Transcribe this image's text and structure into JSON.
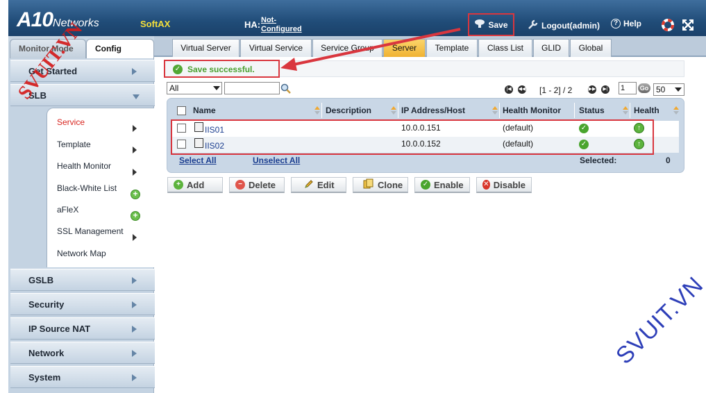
{
  "header": {
    "logo_main": "A10",
    "logo_sub": "Networks",
    "product": "SoftAX",
    "ha_label": "HA:",
    "ha_status": "Not-Configured",
    "save_label": "Save",
    "logout_label": "Logout(admin)",
    "help_label": "Help"
  },
  "mode_tabs": {
    "monitor": "Monitor Mode",
    "config": "Config Mode"
  },
  "sidebar": {
    "items": [
      {
        "label": "Get Started"
      },
      {
        "label": "SLB"
      },
      {
        "label": "GSLB"
      },
      {
        "label": "Security"
      },
      {
        "label": "IP Source NAT"
      },
      {
        "label": "Network"
      },
      {
        "label": "System"
      }
    ],
    "submenu": [
      {
        "label": "Service"
      },
      {
        "label": "Template"
      },
      {
        "label": "Health Monitor"
      },
      {
        "label": "Black-White List"
      },
      {
        "label": "aFleX"
      },
      {
        "label": "SSL Management"
      },
      {
        "label": "Network Map"
      }
    ]
  },
  "tabs": [
    {
      "label": "Virtual Server"
    },
    {
      "label": "Virtual Service"
    },
    {
      "label": "Service Group"
    },
    {
      "label": "Server"
    },
    {
      "label": "Template"
    },
    {
      "label": "Class List"
    },
    {
      "label": "GLID"
    },
    {
      "label": "Global"
    }
  ],
  "message": {
    "text": "Save successful."
  },
  "filter": {
    "selected": "All",
    "value": ""
  },
  "pagination": {
    "range": "[1 - 2] / 2",
    "page": "1",
    "go": "Go",
    "per_page": "50"
  },
  "table": {
    "columns": [
      "Name",
      "Description",
      "IP Address/Host",
      "Health Monitor",
      "Status",
      "Health"
    ],
    "rows": [
      {
        "name": "IIS01",
        "description": "",
        "ip": "10.0.0.151",
        "monitor": "(default)"
      },
      {
        "name": "IIS02",
        "description": "",
        "ip": "10.0.0.152",
        "monitor": "(default)"
      }
    ],
    "select_all": "Select All",
    "unselect_all": "Unselect All",
    "selected_label": "Selected:",
    "selected_count": "0"
  },
  "actions": {
    "add": "Add",
    "delete": "Delete",
    "edit": "Edit",
    "clone": "Clone",
    "enable": "Enable",
    "disable": "Disable"
  },
  "watermarks": {
    "top_left": "SVUIT.VN",
    "bottom_right": "SVUIT.VN"
  },
  "colors": {
    "accent": "#204c78",
    "highlight": "#d9363e",
    "success": "#4a9f2f",
    "active_tab": "#f0b232"
  }
}
